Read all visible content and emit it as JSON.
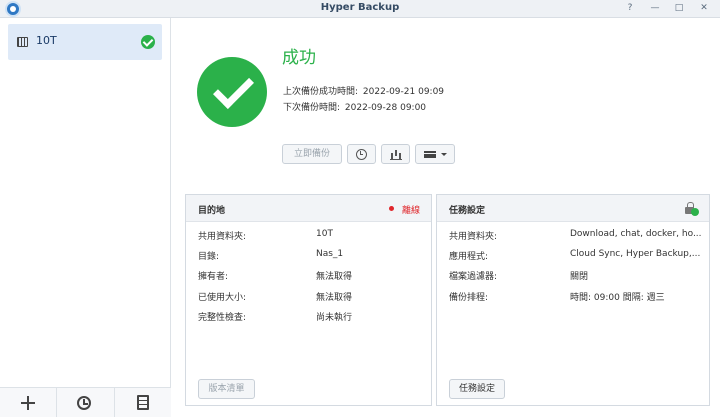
{
  "window": {
    "title": "Hyper Backup",
    "help_glyph": "?",
    "minimize_glyph": "—",
    "maximize_glyph": "□",
    "close_glyph": "✕"
  },
  "sidebar": {
    "tasks": [
      {
        "label": "10T",
        "status_icon": "check-circle-icon"
      }
    ],
    "bottom_buttons": [
      {
        "icon": "plus-icon"
      },
      {
        "icon": "restore-history-icon"
      },
      {
        "icon": "log-document-icon"
      }
    ]
  },
  "status": {
    "title": "成功",
    "last_backup_label": "上次備份成功時間:",
    "last_backup_value": "2022-09-21 09:09",
    "next_backup_label": "下次備份時間:",
    "next_backup_value": "2022-09-28 09:00"
  },
  "actions": {
    "backup_now": "立即備份"
  },
  "destination": {
    "title": "目的地",
    "status": "離線",
    "status_color": "#e0262b",
    "rows": [
      {
        "label": "共用資料夾:",
        "value": "10T"
      },
      {
        "label": "目錄:",
        "value": "Nas_1"
      },
      {
        "label": "擁有者:",
        "value": "無法取得"
      },
      {
        "label": "已使用大小:",
        "value": "無法取得"
      },
      {
        "label": "完整性檢查:",
        "value": "尚未執行"
      }
    ],
    "button": "版本清單"
  },
  "task_settings": {
    "title": "任務設定",
    "rows": [
      {
        "label": "共用資料夾:",
        "value": "Download, chat, docker, ho..."
      },
      {
        "label": "應用程式:",
        "value": "Cloud Sync, Hyper Backup,..."
      },
      {
        "label": "檔案過濾器:",
        "value": "關閉"
      },
      {
        "label": "備份排程:",
        "value": "時間: 09:00 間隔: 週三"
      }
    ],
    "button": "任務設定"
  },
  "colors": {
    "success": "#2bb14a",
    "selected_bg": "#dfeaf8",
    "title_text": "#354b64"
  }
}
